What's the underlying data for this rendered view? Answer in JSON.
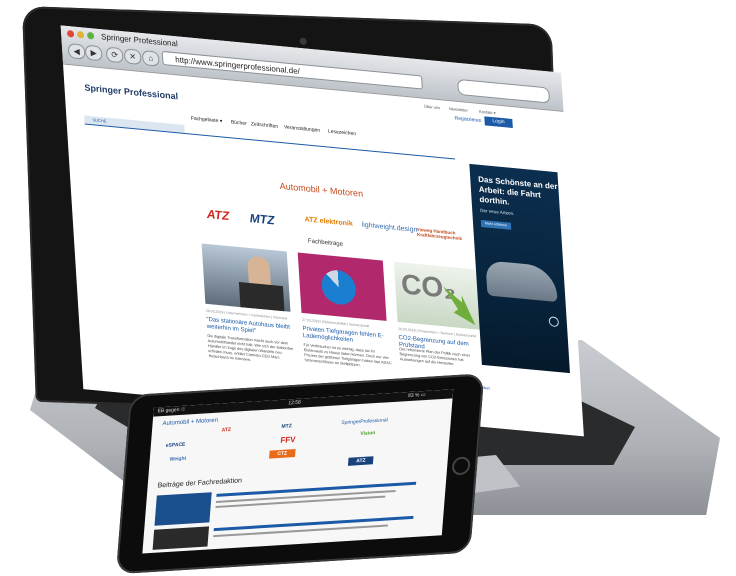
{
  "browser": {
    "window_title": "Springer Professional",
    "url": "http://www.springerprofessional.de/",
    "back": "◀",
    "forward": "▶",
    "reload": "⟳",
    "stop": "✕",
    "home": "⌂"
  },
  "header": {
    "top_links": [
      "Über uns",
      "Newsletter",
      "Kontakt ▾"
    ],
    "register": "Registrieren",
    "login": "Login",
    "logo": "Springer Professional",
    "nav": [
      "Fachgebiete ▾",
      "Bücher",
      "Zeitschriften",
      "Veranstaltungen",
      "Lesezeichen"
    ],
    "search": "SUCHE"
  },
  "main": {
    "section_title": "Automobil + Motoren",
    "brands": [
      "ATZ",
      "MTZ",
      "ATZ elektronik",
      "lightweight.design",
      "Vieweg Handbuch Kraftfahrzeugtechnik"
    ],
    "subtitle": "Fachbeiträge",
    "articles": [
      {
        "meta": "29.03.2019 | Unternehmen + Institutionen | Interview",
        "headline": "\"Das stationäre Autohaus bleibt weiterhin im Spiel\"",
        "body": "Die digitale Transformation macht auch vor dem Automobilhandel nicht halt. Wie sich der stationäre Händler im Zuge des digitalen Wandels neu erfinden muss, erklärt Carmeto-CEO Marc Hetschbach im Interview."
      },
      {
        "meta": "27.03.2019 | Elektromobilität | Schwerpunkt",
        "headline": "Privaten Tiefgaragen fehlen E-Lademöglichkeiten",
        "body": "Für Verbraucher ist es wichtig, dass sie ihr Elektroauto zu Hause laden können. Doch nur vier Prozent der größeren Tiefgaragen haben laut ADAC Stromanschlüsse an Stellplätzen."
      },
      {
        "meta": "26.03.2019 | Emissionen + Normen | Schwerpunkt",
        "headline": "CO2-Begrenzung auf dem Prüfstand",
        "body": "Der reformierte Plan der Politik nach einer Begrenzung von CO2-Emissionen hat Auswirkungen auf die Hersteller."
      }
    ],
    "more": "» weitere Artikel"
  },
  "ad": {
    "headline": "Das Schönste an der Arbeit: die Fahrt dorthin.",
    "sub": "Der neue Arteon.",
    "button": "Mehr erfahren"
  },
  "tablet": {
    "status_left": "EB gegen ☉",
    "status_time": "12:58",
    "status_right": "83 % ▭",
    "section": "Automobil + Motoren",
    "logos": [
      "ATZ",
      "MTZ",
      "SpringerProfessional",
      "eSPACE",
      "FFV",
      "Vision",
      "Weight",
      "CTZ",
      "ATZ"
    ],
    "heading": "Beiträge der Fachredaktion"
  }
}
